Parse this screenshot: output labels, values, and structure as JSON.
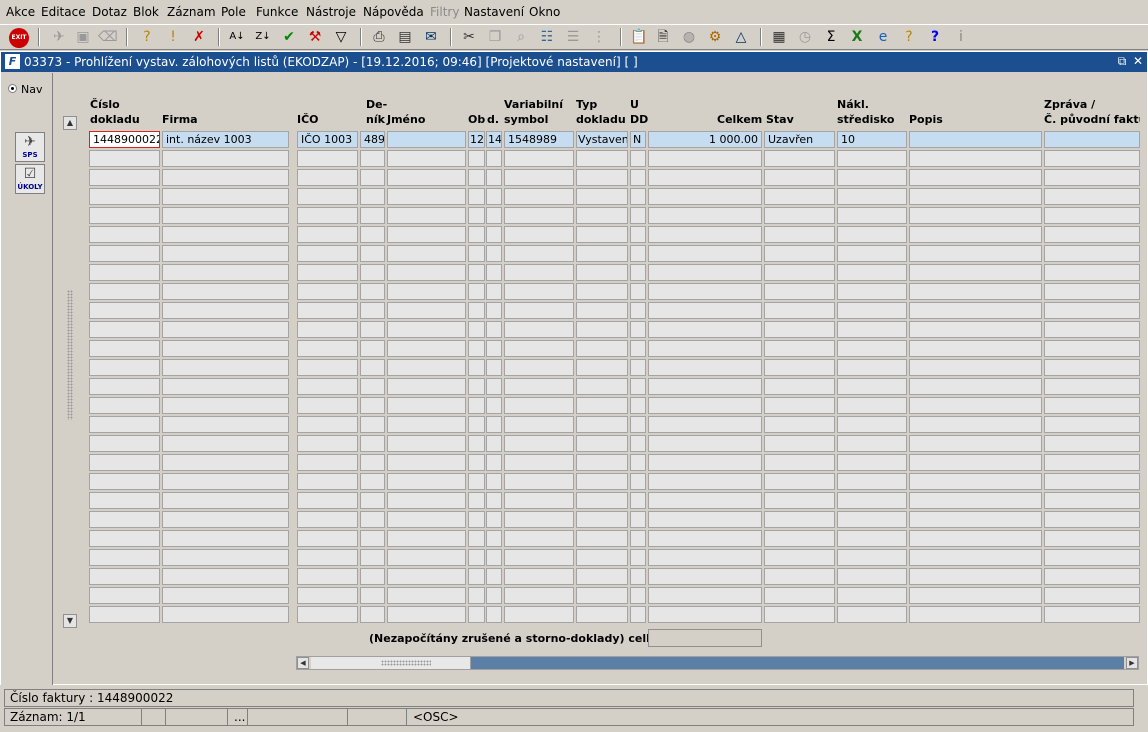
{
  "menu": [
    "Akce",
    "Editace",
    "Dotaz",
    "Blok",
    "Záznam",
    "Pole",
    "Funkce",
    "Nástroje",
    "Nápověda",
    "Filtry",
    "Nastavení",
    "Okno"
  ],
  "toolbar": {
    "exit_label": "EXIT",
    "icons": [
      "clear-record-icon",
      "insert-record-icon",
      "delete-record-icon",
      "query-icon",
      "execute-query-icon",
      "cancel-query-icon",
      "sort-asc-icon",
      "sort-desc-icon",
      "checkmark-icon",
      "tools-icon",
      "filter-icon",
      "print-icon",
      "print-preview-icon",
      "mail-icon",
      "scissors-icon",
      "copy-icon",
      "find-icon",
      "list-icon",
      "tree-icon",
      "clipboard-icon",
      "document-icon",
      "globe-icon",
      "settings-icon",
      "triangle-icon",
      "chart-icon",
      "clock-icon",
      "sigma-icon",
      "excel-icon",
      "ie-icon",
      "hint-icon",
      "help-icon",
      "info-icon"
    ]
  },
  "window": {
    "title": "03373 - Prohlížení vystav. zálohových listů (EKODZAP) - [19.12.2016; 09:46]  [Projektové nastavení]  [ ]",
    "restore_icon": "⧉",
    "close_icon": "✕"
  },
  "left_panel": {
    "nav_label": "Nav",
    "sps_label": "SPS",
    "ukoly_label": "ÚKOLY"
  },
  "columns": {
    "cislo": "Číslo",
    "dokladu": "dokladu",
    "firma": "Firma",
    "ico": "IČO",
    "de": "De-",
    "nik": "ník",
    "jmeno": "Jméno",
    "ob": "Ob",
    "d": "d.",
    "variabilni": "Variabilní",
    "symbol": "symbol",
    "typ": "Typ",
    "dokladu2": "dokladu",
    "u": "U",
    "dd": "DD",
    "celkem": "Celkem",
    "stav": "Stav",
    "nakl": "Nákl.",
    "stredisko": "středisko",
    "popis": "Popis",
    "zprava": "Zpráva /",
    "puvodni": "Č. původní faktur"
  },
  "rows": [
    {
      "cislo": "1448900022",
      "firma": "int. název 1003",
      "ico": "IČO 1003",
      "denik": "489",
      "jmeno": "",
      "ob": "12",
      "d": "14",
      "variabilni": "1548989",
      "typ": "Vystavená",
      "u": "N",
      "celkem": "1 000.00",
      "stav": "Uzavřen",
      "nakl": "10",
      "popis": "",
      "zprava": ""
    }
  ],
  "summary": {
    "label": "(Nezapočítány zrušené a storno-doklady) celkem",
    "value": ""
  },
  "status": {
    "line1": "Číslo faktury : 1448900022",
    "record": "Záznam: 1/1",
    "seg_dots": "...",
    "seg_osc": "<OSC>"
  }
}
